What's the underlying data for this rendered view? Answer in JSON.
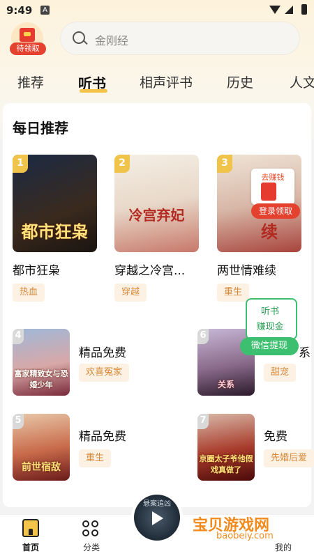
{
  "status_bar": {
    "time": "9:49",
    "notif_icon": "A"
  },
  "header": {
    "gift_label": "待领取",
    "search_placeholder": "金刚经"
  },
  "tabs": [
    "推荐",
    "听书",
    "相声评书",
    "历史",
    "人文"
  ],
  "active_tab": "听书",
  "section": {
    "title": "每日推荐"
  },
  "top_books": [
    {
      "rank": "1",
      "name": "都市狂枭",
      "tag": "热血",
      "cover_text": "都市狂枭"
    },
    {
      "rank": "2",
      "name": "穿越之冷宫...",
      "tag": "穿越",
      "cover_text": "冷宫弃妃"
    },
    {
      "rank": "3",
      "name": "两世情难续",
      "tag": "重生",
      "cover_text": "续"
    }
  ],
  "list_books": [
    {
      "rank": "4",
      "name": "精品免费",
      "tag": "欢喜冤家",
      "cover_text": "富家精致女与恐婚少年"
    },
    {
      "rank": "6",
      "name": "系",
      "tag": "甜宠",
      "cover_text": "关系"
    },
    {
      "rank": "5",
      "name": "精品免费",
      "tag": "重生",
      "cover_text": "前世宿敌"
    },
    {
      "rank": "7",
      "name": "免费",
      "tag": "先婚后爱",
      "cover_text": "京圈太子爷他假戏真做了"
    }
  ],
  "float_earn": {
    "title": "去赚钱",
    "button": "登录领取"
  },
  "float_listen": {
    "line1": "听书",
    "line2": "赚现金",
    "button": "微信提现"
  },
  "bottom_nav": [
    {
      "label": "首页",
      "icon": "home-icon"
    },
    {
      "label": "分类",
      "icon": "grid-icon"
    },
    {
      "label": "我的",
      "icon": "user-icon"
    }
  ],
  "player": {
    "title": "悬案追凶"
  },
  "watermark": {
    "title": "宝贝游戏网",
    "url": "baobeiy.com"
  },
  "colors": {
    "accent": "#f4c44a",
    "red": "#e5412f",
    "green": "#3cbf6e",
    "tag_text": "#d58a3a"
  }
}
